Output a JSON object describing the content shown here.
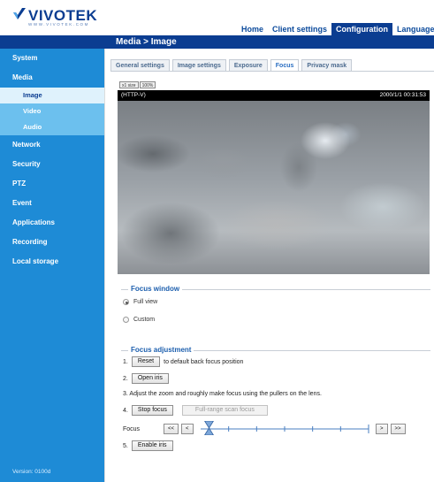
{
  "header": {
    "logo_text": "VIVOTEK",
    "logo_url": "WWW.VIVOTEK.COM",
    "nav": [
      {
        "label": "Home",
        "active": false
      },
      {
        "label": "Client settings",
        "active": false
      },
      {
        "label": "Configuration",
        "active": true
      },
      {
        "label": "Language",
        "active": false
      }
    ]
  },
  "title": "Media > Image",
  "sidebar": {
    "sections": [
      {
        "label": "System"
      },
      {
        "label": "Media",
        "children": [
          {
            "label": "Image",
            "active": true
          },
          {
            "label": "Video",
            "active": false
          },
          {
            "label": "Audio",
            "active": false
          }
        ]
      },
      {
        "label": "Network"
      },
      {
        "label": "Security"
      },
      {
        "label": "PTZ"
      },
      {
        "label": "Event"
      },
      {
        "label": "Applications"
      },
      {
        "label": "Recording"
      },
      {
        "label": "Local storage"
      }
    ],
    "version": "Version: 0100d"
  },
  "tabs": [
    {
      "label": "General settings",
      "active": false
    },
    {
      "label": "Image settings",
      "active": false
    },
    {
      "label": "Exposure",
      "active": false
    },
    {
      "label": "Focus",
      "active": true
    },
    {
      "label": "Privacy mask",
      "active": false
    }
  ],
  "zoom_buttons": [
    "x1 size",
    "100%"
  ],
  "video": {
    "label": "(HTTP-V)",
    "timestamp": "2000/1/1 00:31:53"
  },
  "focus_window": {
    "legend": "Focus window",
    "options": [
      {
        "label": "Full view",
        "checked": true
      },
      {
        "label": "Custom",
        "checked": false
      }
    ]
  },
  "focus_adjustment": {
    "legend": "Focus adjustment",
    "step1": {
      "num": "1.",
      "button": "Reset",
      "text": "to default back focus position"
    },
    "step2": {
      "num": "2.",
      "button": "Open iris"
    },
    "step3": {
      "text": "3. Adjust the zoom and roughly make focus using the pullers on the lens."
    },
    "step4": {
      "num": "4.",
      "button": "Stop focus",
      "button2": "Full-range scan focus"
    },
    "focus_label": "Focus",
    "nav_buttons": [
      "<<",
      "<",
      ">",
      ">>"
    ],
    "slider_position": 0.05,
    "step5": {
      "num": "5.",
      "button": "Enable iris"
    }
  },
  "colors": {
    "brand_dark": "#0b3d91",
    "sidebar": "#1e8bd6",
    "sidebar_sub": "#6cc0ee"
  }
}
